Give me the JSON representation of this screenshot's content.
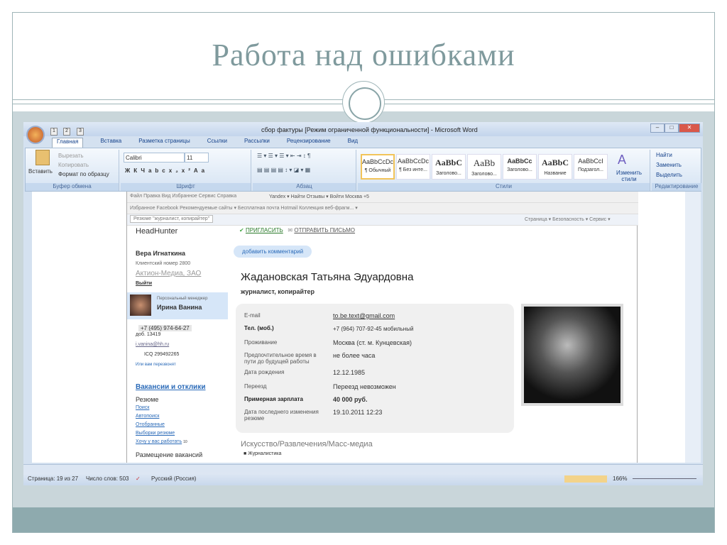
{
  "slide": {
    "title": "Работа над ошибками"
  },
  "word": {
    "window_title": "сбор фактуры [Режим ограниченной функциональности] - Microsoft Word",
    "quick_access_keys": [
      "1",
      "2",
      "3"
    ],
    "tabs": [
      {
        "label": "Главная",
        "key": "Я"
      },
      {
        "label": "Вставка",
        "key": "С"
      },
      {
        "label": "Разметка страницы",
        "key": "З"
      },
      {
        "label": "Ссылки",
        "key": "К"
      },
      {
        "label": "Рассылки",
        "key": "Ы"
      },
      {
        "label": "Рецензирование",
        "key": "И"
      },
      {
        "label": "Вид",
        "key": "О"
      }
    ],
    "clipboard": {
      "paste": "Вставить",
      "cut": "Вырезать",
      "copy": "Копировать",
      "format": "Формат по образцу",
      "label": "Буфер обмена"
    },
    "font": {
      "name": "Calibri",
      "size": "11",
      "label": "Шрифт",
      "buttons": [
        "Ж",
        "К",
        "Ч",
        "abc",
        "x₂",
        "x²",
        "Aa"
      ]
    },
    "paragraph": {
      "label": "Абзац"
    },
    "styles": {
      "label": "Стили",
      "items": [
        {
          "sample": "AaBbCcDc",
          "name": "¶ Обычный"
        },
        {
          "sample": "AaBbCcDc",
          "name": "¶ Без инте..."
        },
        {
          "sample": "AaBbC",
          "name": "Заголово..."
        },
        {
          "sample": "AaBb",
          "name": "Заголово..."
        },
        {
          "sample": "AaBbCc",
          "name": "Заголово..."
        },
        {
          "sample": "AaBbC",
          "name": "Название"
        },
        {
          "sample": "AaBbCcI",
          "name": "Подзагол..."
        }
      ],
      "change": "Изменить стили"
    },
    "editing": {
      "label": "Редактирование",
      "find": "Найти",
      "replace": "Заменить",
      "select": "Выделить"
    },
    "status": {
      "page": "Страница: 19 из 27",
      "words": "Число слов: 503",
      "lang": "Русский (Россия)",
      "zoom": "166%"
    }
  },
  "browser": {
    "menu": "Файл   Правка   Вид   Избранное   Сервис   Справка",
    "toolbar": "Yandex ▾   Найти   Отзывы ▾   Войти   Москва +5",
    "favorites": "Избранное   Facebook   Рекомендуемые сайты ▾   Бесплатная почта Hotmail   Коллекция веб-фрагм... ▾",
    "tab": "Резюме \"журналист, копирайтер\"",
    "commands": "Страница ▾  Безопасность ▾  Сервис ▾"
  },
  "hh": {
    "logo": "HeadHunter",
    "user": "Вера Игнаткина",
    "client": "Клиентский номер 2800",
    "company": "Актион-Медиа, ЗАО",
    "logout": "Выйти",
    "manager_label": "Персональный менеджер",
    "manager": "Ирина Ванина",
    "phone": "+7 (495) 974-64-27",
    "ext": "доб. 13419",
    "email": "i.vanina@hh.ru",
    "icq": "ICQ 299492265",
    "callback": "Или вам перезвонят",
    "section": "Вакансии и отклики",
    "resume": "Резюме",
    "links": [
      "Поиск",
      "Автопоиск",
      "Отобранные",
      "Выборки резюме",
      "Хочу у вас работать"
    ],
    "want_count": "10",
    "vacancies": "Размещение вакансий",
    "invite": "ПРИГЛАСИТЬ",
    "send": "ОТПРАВИТЬ ПИСЬМО",
    "comment": "добавить комментарий",
    "name": "Жадановская Татьяна Эдуардовна",
    "position": "журналист, копирайтер",
    "fields": [
      {
        "label": "E-mail",
        "value": "to.be.text@gmail.com"
      },
      {
        "label": "Тел. (моб.)",
        "value": "+7 (964) 707-92-45   мобильный"
      },
      {
        "label": "Проживание",
        "value": "Москва (ст. м. Кунцевская)"
      },
      {
        "label": "Предпочтительное время в пути до будущей работы",
        "value": "не более часа"
      },
      {
        "label": "Дата рождения",
        "value": "12.12.1985"
      },
      {
        "label": "Переезд",
        "value": "Переезд невозможен"
      },
      {
        "label": "Примерная зарплата",
        "value": "40 000 руб."
      },
      {
        "label": "Дата последнего изменения резюме",
        "value": "19.10.2011 12:23"
      }
    ],
    "industry": "Искусство/Развлечения/Масс-медиа",
    "industry_item": "Журналистика"
  }
}
